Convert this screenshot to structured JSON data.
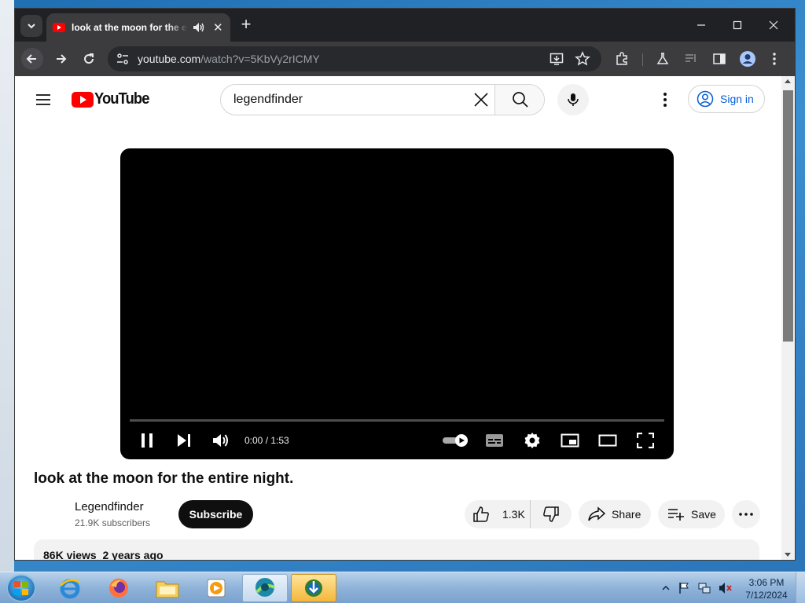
{
  "browser": {
    "tab": {
      "title": "look at the moon for the entire night.",
      "close_glyph": "✕"
    },
    "new_tab_glyph": "+",
    "address": {
      "host": "youtube.com",
      "path": "/watch?v=5KbVy2rICMY"
    }
  },
  "youtube": {
    "search_value": "legendfinder",
    "sign_in_label": "Sign in",
    "logo_text": "YouTube",
    "player": {
      "time": "0:00 / 1:53",
      "progress": 0.0,
      "autoplay_on": true
    },
    "video": {
      "title": "look at the moon for the entire night.",
      "channel": "Legendfinder",
      "subscribers": "21.9K subscribers",
      "subscribe_label": "Subscribe",
      "likes": "1.3K",
      "share_label": "Share",
      "save_label": "Save",
      "views": "86K views",
      "age": "2 years ago"
    }
  },
  "taskbar": {
    "clock_time": "3:06 PM",
    "clock_date": "7/12/2024",
    "apps": [
      "internet-explorer-icon",
      "firefox-icon",
      "file-explorer-icon",
      "media-player-icon",
      "app-icon",
      "download-manager-icon"
    ]
  },
  "colors": {
    "youtube_red": "#ff0000",
    "sign_in_blue": "#065fd4",
    "chrome_dark": "#202124"
  }
}
